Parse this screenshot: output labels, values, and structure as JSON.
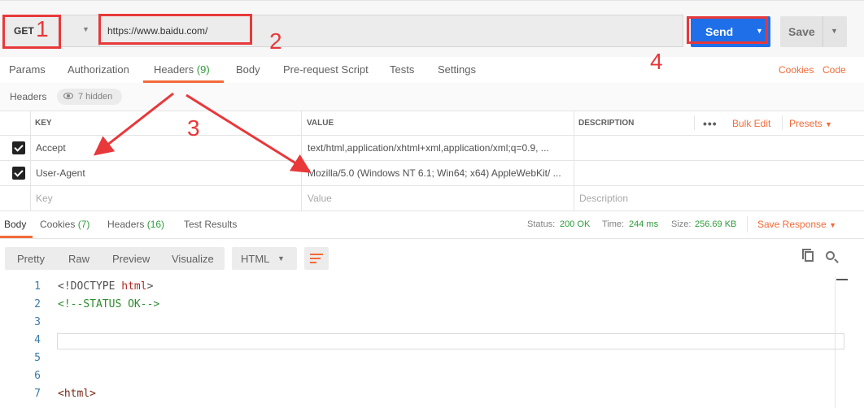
{
  "request": {
    "method": "GET",
    "url": "https://www.baidu.com/",
    "send_label": "Send",
    "save_label": "Save"
  },
  "tabs": [
    {
      "label": "Params"
    },
    {
      "label": "Authorization"
    },
    {
      "label": "Headers",
      "count": "(9)"
    },
    {
      "label": "Body"
    },
    {
      "label": "Pre-request Script"
    },
    {
      "label": "Tests"
    },
    {
      "label": "Settings"
    }
  ],
  "tab_links": {
    "cookies": "Cookies",
    "code": "Code"
  },
  "headers_bar": {
    "label": "Headers",
    "hidden": "7 hidden"
  },
  "table": {
    "columns": {
      "key": "KEY",
      "value": "VALUE",
      "description": "DESCRIPTION"
    },
    "bulk_edit": "Bulk Edit",
    "presets": "Presets",
    "rows": [
      {
        "key": "Accept",
        "value": "text/html,application/xhtml+xml,application/xml;q=0.9, ..."
      },
      {
        "key": "User-Agent",
        "value": "Mozilla/5.0 (Windows NT 6.1; Win64; x64) AppleWebKit/ ..."
      }
    ],
    "placeholders": {
      "key": "Key",
      "value": "Value",
      "description": "Description"
    }
  },
  "response_tabs": [
    {
      "label": "Body"
    },
    {
      "label": "Cookies",
      "count": "(7)"
    },
    {
      "label": "Headers",
      "count": "(16)"
    },
    {
      "label": "Test Results"
    }
  ],
  "status": {
    "status_label": "Status:",
    "status_value": "200 OK",
    "time_label": "Time:",
    "time_value": "244 ms",
    "size_label": "Size:",
    "size_value": "256.69 KB",
    "save_response": "Save Response"
  },
  "view": {
    "buttons": [
      "Pretty",
      "Raw",
      "Preview",
      "Visualize"
    ],
    "format": "HTML"
  },
  "code_lines": [
    {
      "n": "1",
      "segments": [
        {
          "t": "<!DOCTYPE ",
          "c": "#505050"
        },
        {
          "t": "html",
          "c": "#b5281f"
        },
        {
          "t": ">",
          "c": "#505050"
        }
      ]
    },
    {
      "n": "2",
      "segments": [
        {
          "t": "<!--STATUS OK-->",
          "c": "#2d8c2d"
        }
      ]
    },
    {
      "n": "3",
      "segments": []
    },
    {
      "n": "4",
      "segments": []
    },
    {
      "n": "5",
      "segments": []
    },
    {
      "n": "6",
      "segments": []
    },
    {
      "n": "7",
      "segments": [
        {
          "t": "<html>",
          "c": "#7a2a1a"
        }
      ]
    }
  ],
  "annotations": [
    "1",
    "2",
    "3",
    "4"
  ],
  "colors": {
    "accent": "#f26b3a",
    "send": "#1e6fe8",
    "annotation": "#e8383a",
    "ok": "#2d9c3a"
  }
}
